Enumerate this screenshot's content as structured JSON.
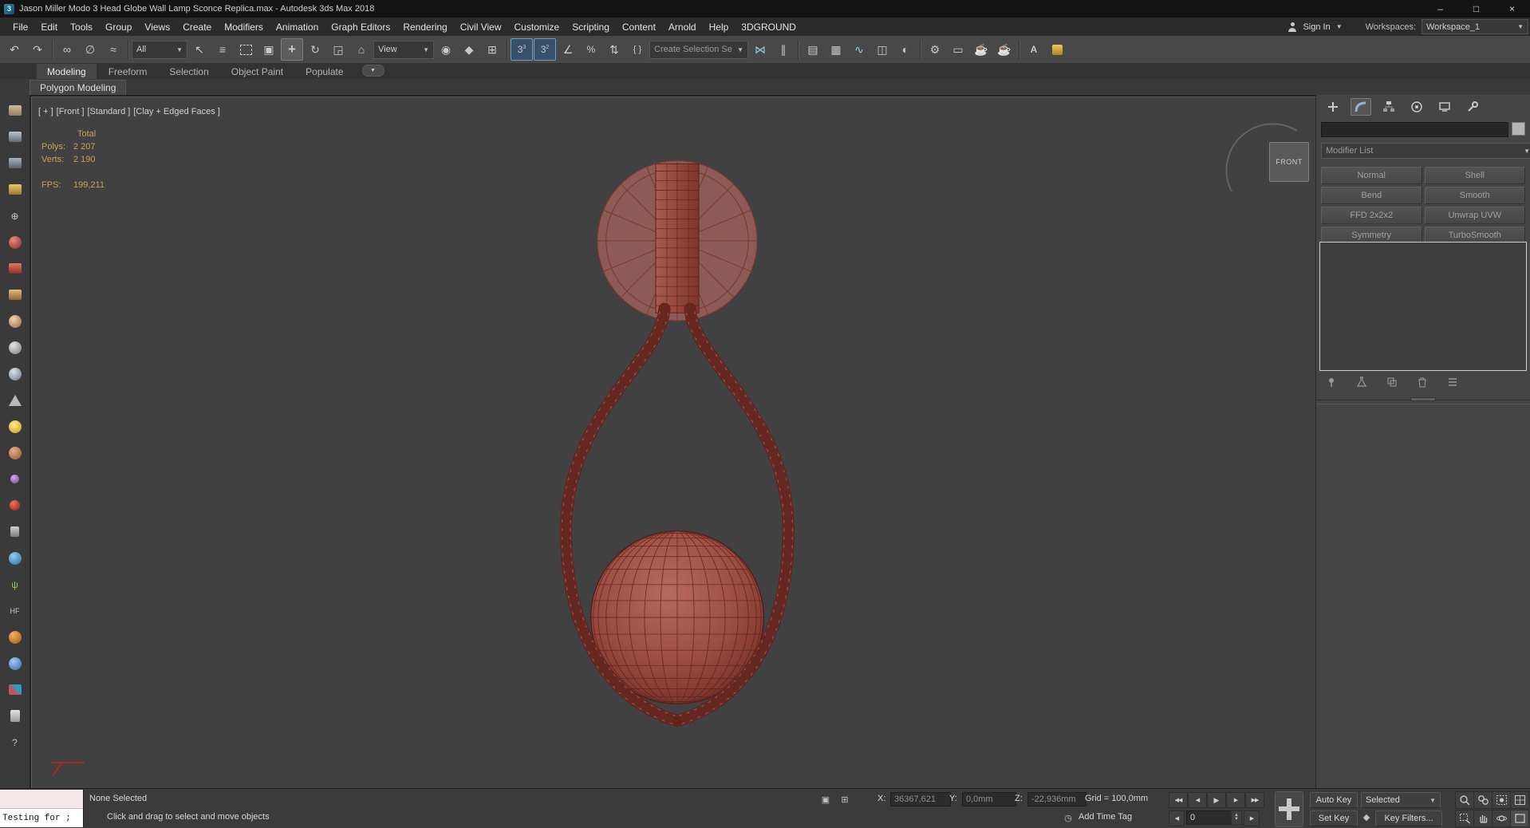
{
  "window": {
    "title": "Jason Miller Modo 3 Head Globe Wall Lamp Sconce Replica.max - Autodesk 3ds Max 2018",
    "logo_glyph": "3"
  },
  "menubar": {
    "items": [
      "File",
      "Edit",
      "Tools",
      "Group",
      "Views",
      "Create",
      "Modifiers",
      "Animation",
      "Graph Editors",
      "Rendering",
      "Civil View",
      "Customize",
      "Scripting",
      "Content",
      "Arnold",
      "Help",
      "3DGROUND"
    ],
    "sign_in": "Sign In",
    "workspaces_label": "Workspaces:",
    "workspace_value": "Workspace_1"
  },
  "toolbar": {
    "selection_filter_value": "All",
    "coord_system_value": "View",
    "named_selection_value": "Create Selection Se"
  },
  "ribbon": {
    "tabs": [
      "Modeling",
      "Freeform",
      "Selection",
      "Object Paint",
      "Populate"
    ],
    "collapsed_panel": "Polygon Modeling"
  },
  "viewport": {
    "label_parts": [
      "[ + ]",
      "[Front ]",
      "[Standard ]",
      "[Clay + Edged Faces ]"
    ],
    "stats": {
      "total": "Total",
      "polys_label": "Polys:",
      "polys_value": "2 207",
      "verts_label": "Verts:",
      "verts_value": "2 190",
      "fps_label": "FPS:",
      "fps_value": "199,211"
    },
    "viewcube": "FRONT"
  },
  "command_panel": {
    "modifier_list_label": "Modifier List",
    "modifier_buttons": [
      "Normal",
      "Shell",
      "Bend",
      "Smooth",
      "FFD 2x2x2",
      "Unwrap UVW",
      "Symmetry",
      "TurboSmooth"
    ]
  },
  "status": {
    "listener_text": "Testing for ;",
    "selection_status": "None Selected",
    "prompt": "Click and drag to select and move objects",
    "x_label": "X:",
    "x_value": "36367,621",
    "y_label": "Y:",
    "y_value": "0,0mm",
    "z_label": "Z:",
    "z_value": "-22,936mm",
    "grid_text": "Grid = 100,0mm",
    "add_time_tag": "Add Time Tag",
    "auto_key": "Auto Key",
    "set_key": "Set Key",
    "key_mode_value": "Selected",
    "key_filters": "Key Filters...",
    "frame_value": "0"
  },
  "colors": {
    "clay_body": "#9c4a41",
    "clay_wire": "#5e241e",
    "viewport_bg": "#414141",
    "stats_text": "#c9a452",
    "snap_active": "#6f9dc6"
  }
}
